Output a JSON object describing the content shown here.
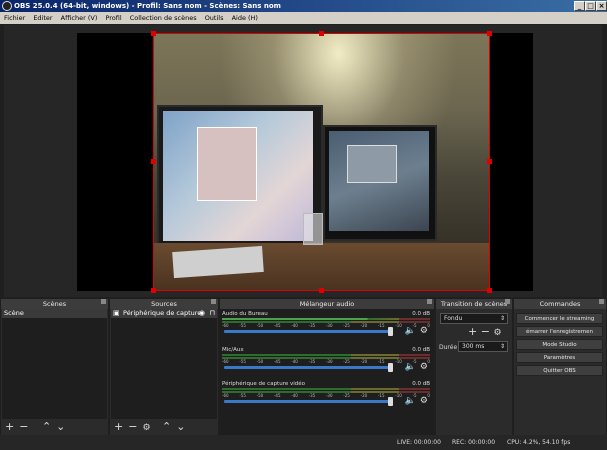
{
  "window": {
    "title": "OBS 25.0.4 (64-bit, windows) - Profil: Sans nom - Scènes: Sans nom",
    "minimize": "_",
    "maximize": "□",
    "close": "×"
  },
  "menu": [
    "Fichier",
    "Editer",
    "Afficher (V)",
    "Profil",
    "Collection de scènes",
    "Outils",
    "Aide (H)"
  ],
  "docks": {
    "scenes": {
      "title": "Scènes",
      "items": [
        "Scène"
      ]
    },
    "sources": {
      "title": "Sources",
      "items": [
        "Périphérique de capture"
      ]
    },
    "mixer": {
      "title": "Mélangeur audio",
      "channels": [
        {
          "name": "Audio du Bureau",
          "db": "0.0 dB",
          "volume": 0.92
        },
        {
          "name": "Mic/Aux",
          "db": "0.0 dB",
          "volume": 0.92
        },
        {
          "name": "Périphérique de capture vidéo",
          "db": "0.0 dB",
          "volume": 0.92
        }
      ],
      "scale": [
        "-60",
        "-55",
        "-50",
        "-45",
        "-40",
        "-35",
        "-30",
        "-25",
        "-20",
        "-15",
        "-10",
        "-5",
        "0"
      ]
    },
    "transitions": {
      "title": "Transition de scènes",
      "selected": "Fondu",
      "duration_label": "Durée",
      "duration_value": "300 ms"
    },
    "controls": {
      "title": "Commandes",
      "buttons": [
        "Commencer le streaming",
        "émarrer l'enregistremen",
        "Mode Studio",
        "Paramètres",
        "Quitter OBS"
      ]
    }
  },
  "toolbar_icons": {
    "add": "+",
    "remove": "−",
    "up": "⌃",
    "down": "⌄",
    "settings": "⚙"
  },
  "status": {
    "live": "LIVE: 00:00:00",
    "rec": "REC: 00:00:00",
    "cpu": "CPU: 4.2%, 54.10 fps"
  },
  "colors": {
    "selection": "#e00000",
    "slider": "#3a78c8",
    "meter_green": "#4ca24c"
  }
}
